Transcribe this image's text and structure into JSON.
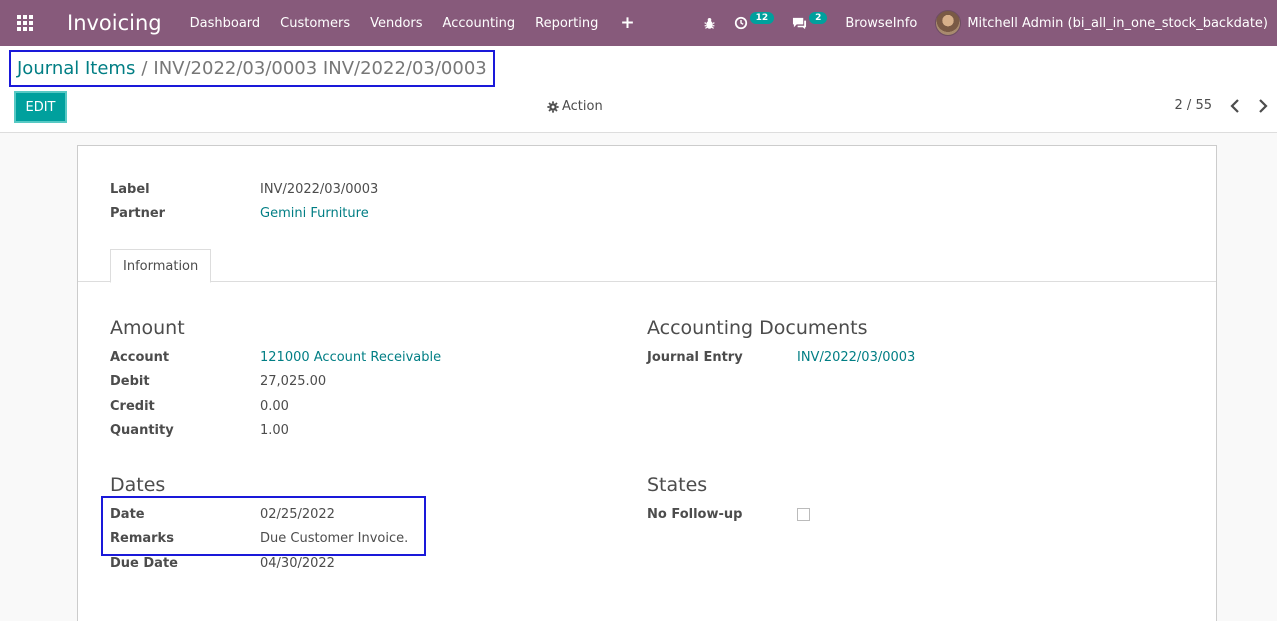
{
  "navbar": {
    "app_title": "Invoicing",
    "menu": [
      "Dashboard",
      "Customers",
      "Vendors",
      "Accounting",
      "Reporting"
    ],
    "plus": "+",
    "activity_count": "12",
    "messages_count": "2",
    "company": "BrowseInfo",
    "user": "Mitchell Admin (bi_all_in_one_stock_backdate)"
  },
  "breadcrumb": {
    "parent": "Journal Items",
    "separator": "/",
    "current": "INV/2022/03/0003 INV/2022/03/0003"
  },
  "toolbar": {
    "edit_label": "EDIT",
    "action_label": "Action",
    "pager": "2 / 55"
  },
  "form": {
    "label": {
      "label": "Label",
      "value": "INV/2022/03/0003"
    },
    "partner": {
      "label": "Partner",
      "value": "Gemini Furniture"
    },
    "tab": "Information",
    "amount": {
      "title": "Amount",
      "account": {
        "label": "Account",
        "value": "121000 Account Receivable"
      },
      "debit": {
        "label": "Debit",
        "value": "27,025.00"
      },
      "credit": {
        "label": "Credit",
        "value": "0.00"
      },
      "quantity": {
        "label": "Quantity",
        "value": "1.00"
      }
    },
    "accounting_documents": {
      "title": "Accounting Documents",
      "journal_entry": {
        "label": "Journal Entry",
        "value": "INV/2022/03/0003"
      }
    },
    "dates": {
      "title": "Dates",
      "date": {
        "label": "Date",
        "value": "02/25/2022"
      },
      "remarks": {
        "label": "Remarks",
        "value": "Due Customer Invoice."
      },
      "due_date": {
        "label": "Due Date",
        "value": "04/30/2022"
      }
    },
    "states": {
      "title": "States",
      "no_followup": {
        "label": "No Follow-up",
        "checked": false
      }
    }
  },
  "colors": {
    "navbar": "#875a7b",
    "accent": "#00a09d",
    "link": "#017e84",
    "highlight": "#1a19d9"
  }
}
